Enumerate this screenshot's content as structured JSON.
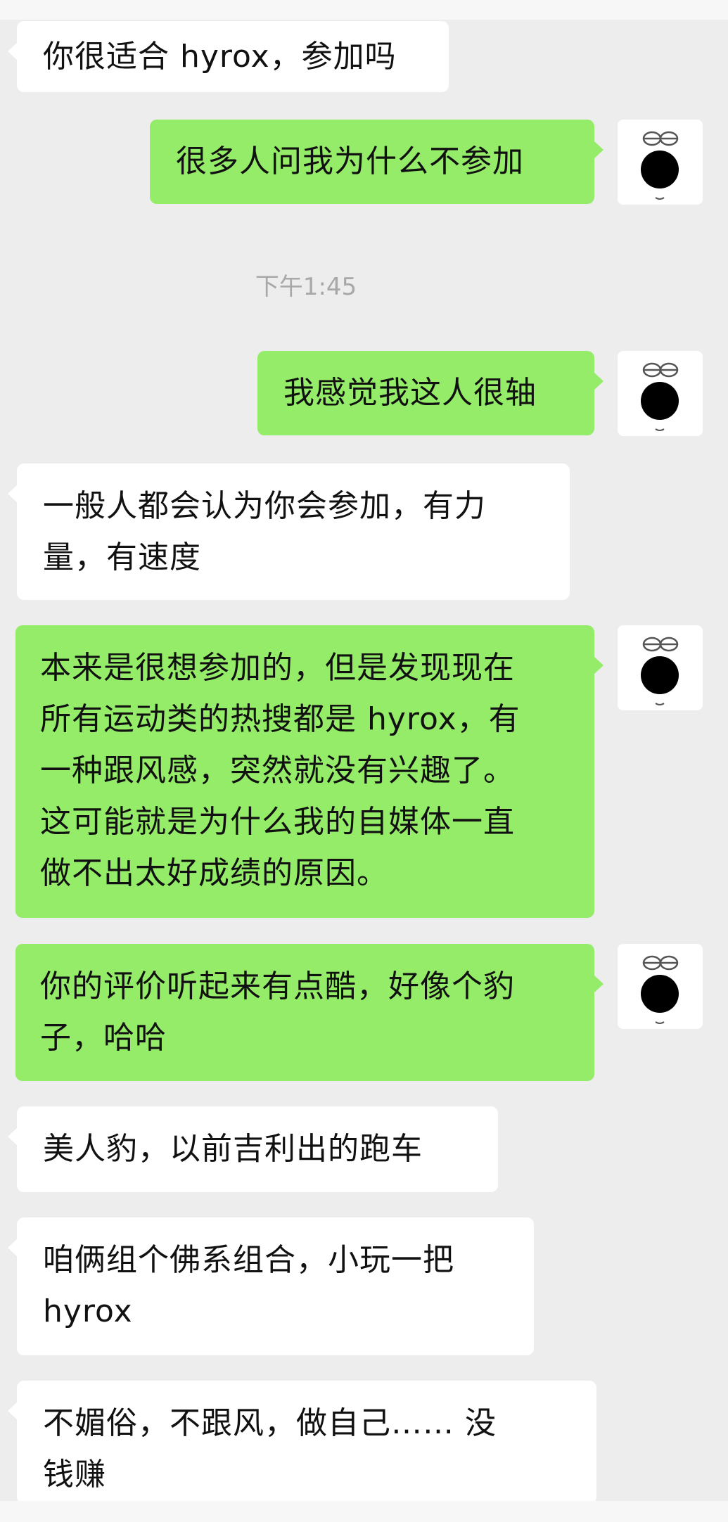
{
  "chat": {
    "timestamp": "下午1:45",
    "messages": [
      {
        "side": "left",
        "text": "你很适合 hyrox，参加吗"
      },
      {
        "side": "right",
        "text": "很多人问我为什么不参加"
      },
      {
        "side": "right",
        "text": "我感觉我这人很轴"
      },
      {
        "side": "left",
        "text": "一般人都会认为你会参加，有力\n量，有速度"
      },
      {
        "side": "right",
        "text": "本来是很想参加的，但是发现现在\n所有运动类的热搜都是 hyrox，有\n一种跟风感，突然就没有兴趣了。\n这可能就是为什么我的自媒体一直\n做不出太好成绩的原因。"
      },
      {
        "side": "right",
        "text": "你的评价听起来有点酷，好像个豹\n子，哈哈"
      },
      {
        "side": "left",
        "text": "美人豹，以前吉利出的跑车"
      },
      {
        "side": "left",
        "text": "咱俩组个佛系组合，小玩一把\nhyrox"
      },
      {
        "side": "left",
        "text": "不媚俗，不跟风，做自己…… 没\n钱赚"
      }
    ]
  },
  "colors": {
    "background": "#ededed",
    "incoming_bubble": "#ffffff",
    "outgoing_bubble": "#95ec69",
    "timestamp_text": "#a8a8a8"
  },
  "icons": {
    "self_avatar": "sleepy-face-avatar-icon"
  }
}
